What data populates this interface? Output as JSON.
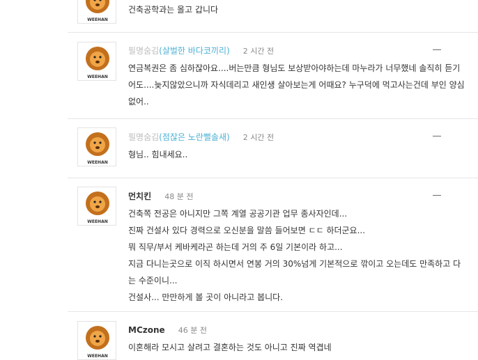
{
  "comments": [
    {
      "author": "",
      "nickname": "",
      "time": "",
      "lines": [
        "건축공학과는 올고 갑니다"
      ]
    },
    {
      "author": "필명숨김",
      "nickname": "(살벌한 바다코끼리)",
      "time": "2 시간 전",
      "lines": [
        "연금복권은 좀 심하잖아요....버는만큼 형님도 보상받아야하는데 마누라가 너무했네 솔직히 듣기",
        "어도....늦지않았으니까 자식데리고 새인생 살아보는게 어때요? 누구덕에 먹고사는건데 부인 양심",
        "없어.."
      ]
    },
    {
      "author": "필명숨김",
      "nickname": "(점잖은 노란뻘솔새)",
      "time": "2 시간 전",
      "lines": [
        "형님.. 힘내세요.."
      ]
    },
    {
      "author": "먼치킨",
      "nickname": "",
      "time": "48 분 전",
      "lines": [
        "건축쪽 전공은 아니지만 그쪽 계열 공공기관 업무 종사자인데...",
        "진짜 건설사 있다 경력으로 오신분을 말씀 들어보면 ㄷㄷ 하더군요...",
        "뭐 직무/부서 케바케라곤 하는데 거의 주 6일 기본이라 하고...",
        "지금 다니는곳으로 이직 하시면서 연봉 거의 30%넘게 기본적으로 깎이고 오는데도 만족하고 다",
        "는 수준이니...",
        "건설사... 만만하게 볼 곳이 아니라고 봅니다."
      ]
    },
    {
      "author": "MCzone",
      "nickname": "",
      "time": "46 분 전",
      "lines": [
        "이혼해라 모시고 살려고 결혼하는 것도 아니고 진짜 역겹네"
      ]
    }
  ],
  "avatar_caption": "WEEHAN",
  "colors": {
    "nickname": "#4cb0d4",
    "hidden_author": "#bbbbbb",
    "separator": "#e6e6e6"
  },
  "icons": {
    "avatar": "lion-avatar-icon",
    "menu": "dash-menu-icon"
  }
}
